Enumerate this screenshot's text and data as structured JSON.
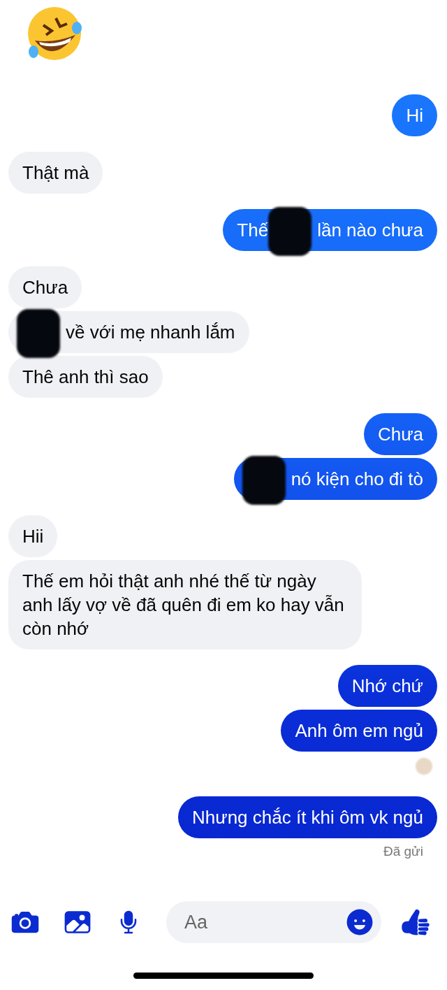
{
  "messages": [
    {
      "kind": "emoji"
    },
    {
      "kind": "text",
      "sent": true,
      "text": "Hi"
    },
    {
      "kind": "text",
      "sent": false,
      "text": "Thật mà"
    },
    {
      "kind": "redacted",
      "sent": true,
      "before": "Thế",
      "after": "lần nào chưa"
    },
    {
      "kind": "text",
      "sent": false,
      "text": "Chưa"
    },
    {
      "kind": "redacted",
      "sent": false,
      "after": "về với mẹ nhanh lắm"
    },
    {
      "kind": "text",
      "sent": false,
      "text": "Thê anh thì sao"
    },
    {
      "kind": "text",
      "sent": true,
      "text": "Chưa"
    },
    {
      "kind": "redacted",
      "sent": true,
      "after": "nó kiện cho đi tò"
    },
    {
      "kind": "text",
      "sent": false,
      "text": "Hii"
    },
    {
      "kind": "text",
      "sent": false,
      "text": "Thế em hỏi thật anh nhé thế từ ngày anh lấy vợ về đã quên đi em ko hay vẫn còn nhớ"
    },
    {
      "kind": "text",
      "sent": true,
      "text": "Nhớ chứ"
    },
    {
      "kind": "text",
      "sent": true,
      "text": "Anh ôm em ngủ"
    },
    {
      "kind": "seen"
    },
    {
      "kind": "text",
      "sent": true,
      "text": "Nhưng chắc ít khi ôm vk ngủ"
    }
  ],
  "status": "Đã gửi",
  "composer": {
    "placeholder": "Aa"
  }
}
